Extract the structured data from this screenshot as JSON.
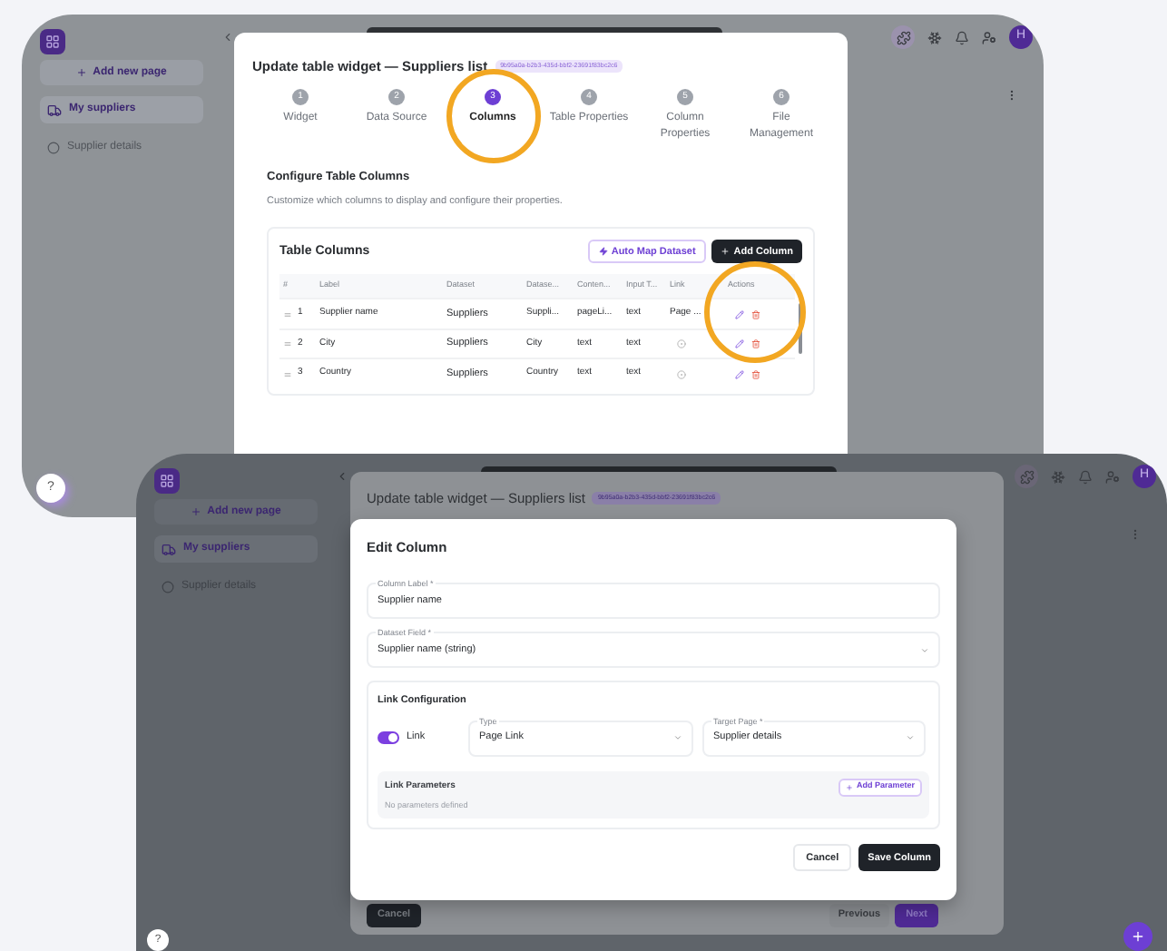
{
  "screenshots": [
    {
      "sidebar": {
        "add_button": "Add new page",
        "items": [
          {
            "label": "My suppliers",
            "kind": "truck",
            "selected": true
          },
          {
            "label": "Supplier details",
            "kind": "circle",
            "selected": false
          }
        ]
      },
      "avatar": "H",
      "help_button": "?",
      "widget_dialog": {
        "title": "Update table widget — Suppliers list",
        "id_badge": "9b95a0a-b2b3-435d-bbf2-23691f83bc2c6",
        "steps": [
          {
            "number": "1",
            "label": "Widget",
            "selected": false
          },
          {
            "number": "2",
            "label": "Data Source",
            "selected": false
          },
          {
            "number": "3",
            "label": "Columns",
            "selected": true
          },
          {
            "number": "4",
            "label": "Table Properties",
            "selected": false
          },
          {
            "number": "5",
            "label": "Column Properties",
            "selected": false
          },
          {
            "number": "6",
            "label": "File Management",
            "selected": false
          }
        ],
        "section_title": "Configure Table Columns",
        "section_subtitle": "Customize which columns to display and configure their properties.",
        "table_card": {
          "title": "Table Columns",
          "auto_map_button": "Auto Map Dataset",
          "add_button": "Add Column",
          "columns": [
            "#",
            "Label",
            "Dataset",
            "Datase...",
            "Conten...",
            "Input T...",
            "Link",
            "Actions"
          ],
          "rows": [
            {
              "number": "1",
              "label": "Supplier name",
              "dataset": "Suppliers",
              "field": "Suppli...",
              "content": "pageLi...",
              "input": "text",
              "link": "Page ..."
            },
            {
              "number": "2",
              "label": "City",
              "dataset": "Suppliers",
              "field": "City",
              "content": "text",
              "input": "text"
            },
            {
              "number": "3",
              "label": "Country",
              "dataset": "Suppliers",
              "field": "Country",
              "content": "text",
              "input": "text"
            }
          ]
        }
      }
    },
    {
      "sidebar": {
        "add_button": "Add new page",
        "items": [
          {
            "label": "My suppliers",
            "kind": "truck",
            "selected": true
          },
          {
            "label": "Supplier details",
            "kind": "circle",
            "selected": false
          }
        ]
      },
      "avatar": "H",
      "help_button": "?",
      "widget_dialog": {
        "title": "Update table widget — Suppliers list",
        "id_badge": "9b95a0a-b2b3-435d-bbf2-23691f83bc2c6",
        "footer": {
          "cancel": "Cancel",
          "previous": "Previous",
          "next": "Next"
        }
      },
      "edit_dialog": {
        "title": "Edit Column",
        "column_label": {
          "label": "Column Label *",
          "value": "Supplier name"
        },
        "dataset_field": {
          "label": "Dataset Field *",
          "value": "Supplier name (string)"
        },
        "link_configuration": {
          "title": "Link Configuration",
          "toggle": {
            "label": "Link",
            "on": true
          },
          "type": {
            "label": "Type",
            "value": "Page Link"
          },
          "target_page": {
            "label": "Target Page *",
            "value": "Supplier details"
          },
          "parameters": {
            "title": "Link Parameters",
            "add_button": "Add Parameter",
            "empty_text": "No parameters defined"
          }
        },
        "cancel_button": "Cancel",
        "save_button": "Save Column"
      }
    }
  ]
}
